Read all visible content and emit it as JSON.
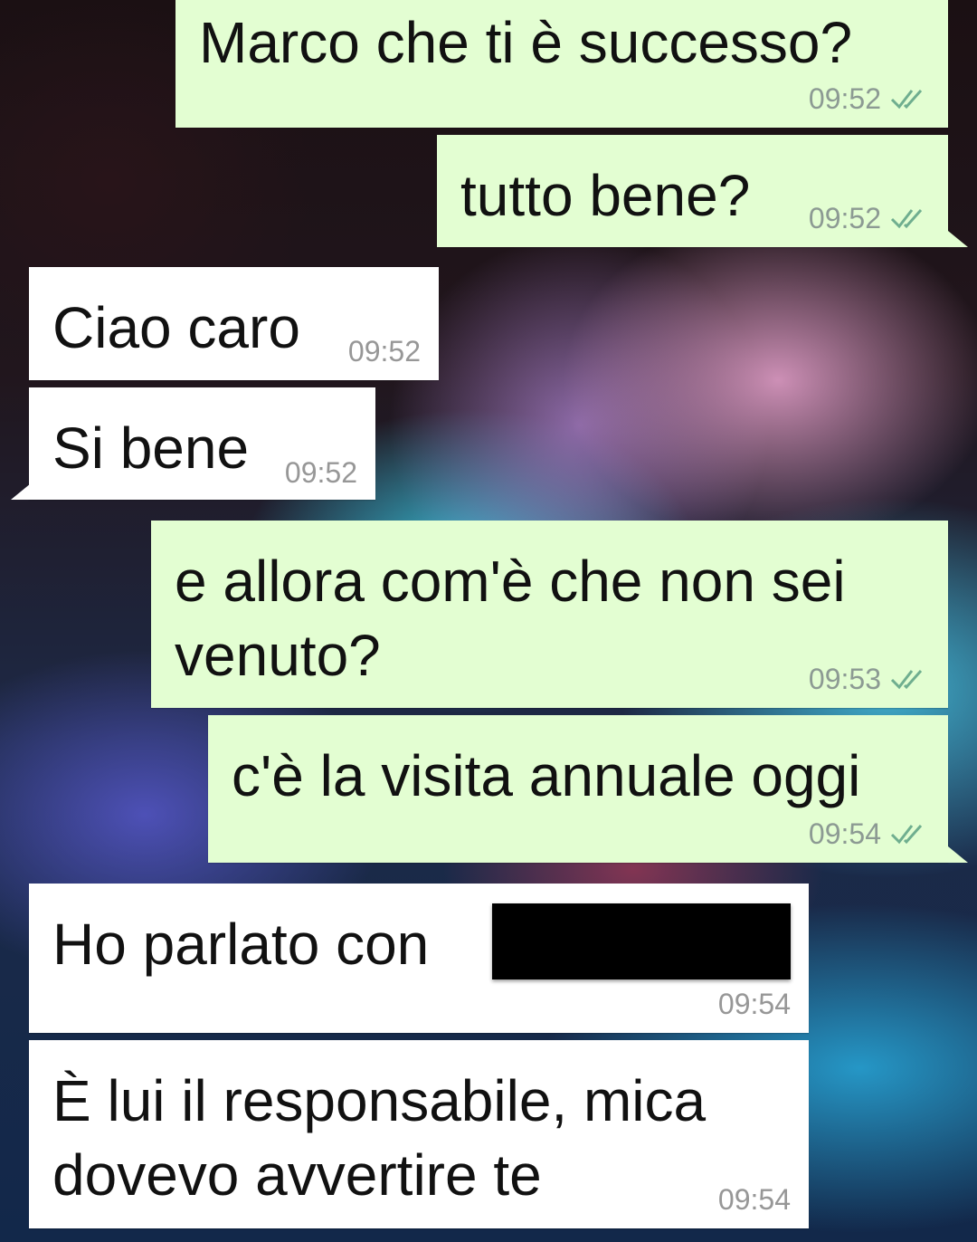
{
  "chat": {
    "messages": [
      {
        "direction": "outgoing",
        "text": "Marco che ti è successo?",
        "time": "09:52",
        "status": "read"
      },
      {
        "direction": "outgoing",
        "text": "tutto bene?",
        "time": "09:52",
        "status": "read"
      },
      {
        "direction": "incoming",
        "text": "Ciao caro",
        "time": "09:52"
      },
      {
        "direction": "incoming",
        "text": "Si bene",
        "time": "09:52"
      },
      {
        "direction": "outgoing",
        "text_line1": "e allora com'è che non sei",
        "text_line2": "venuto?",
        "time": "09:53",
        "status": "read"
      },
      {
        "direction": "outgoing",
        "text": "c'è la visita annuale oggi",
        "time": "09:54",
        "status": "read"
      },
      {
        "direction": "incoming",
        "text": "Ho parlato con",
        "redacted": true,
        "time": "09:54"
      },
      {
        "direction": "incoming",
        "text_line1": "È lui il responsabile, mica",
        "text_line2": "dovevo avvertire te",
        "time": "09:54"
      }
    ]
  },
  "colors": {
    "outgoing_bubble": "#e3fed2",
    "incoming_bubble": "#ffffff",
    "read_ticks": "#34b7f1",
    "redaction": "#000000"
  },
  "icons": {
    "read_receipt": "double-check-icon"
  }
}
